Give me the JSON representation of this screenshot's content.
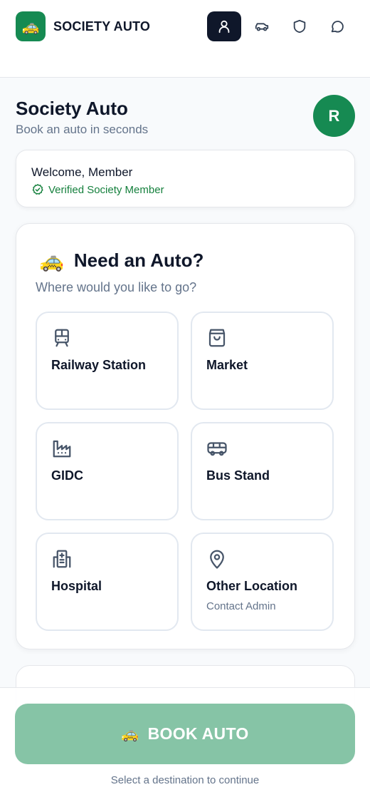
{
  "header": {
    "logo_emoji": "🚕",
    "brand": "SOCIETY AUTO",
    "nav": [
      {
        "icon": "user-icon",
        "active": true
      },
      {
        "icon": "car-icon",
        "active": false
      },
      {
        "icon": "shield-icon",
        "active": false
      },
      {
        "icon": "chat-icon",
        "active": false
      }
    ]
  },
  "page": {
    "title": "Society Auto",
    "subtitle": "Book an auto in seconds",
    "avatar_initial": "R"
  },
  "welcome": {
    "greeting": "Welcome, Member",
    "status": "Verified Society Member"
  },
  "booking": {
    "emoji": "🚕",
    "title": "Need an Auto?",
    "subtitle": "Where would you like to go?",
    "destinations": [
      {
        "label": "Railway Station",
        "icon": "train-icon"
      },
      {
        "label": "Market",
        "icon": "shopping-bag-icon"
      },
      {
        "label": "GIDC",
        "icon": "factory-icon"
      },
      {
        "label": "Bus Stand",
        "icon": "bus-icon"
      },
      {
        "label": "Hospital",
        "icon": "hospital-icon"
      },
      {
        "label": "Other Location",
        "sub": "Contact Admin",
        "icon": "map-pin-icon"
      }
    ]
  },
  "footer": {
    "button_emoji": "🚕",
    "button_label": "BOOK AUTO",
    "hint": "Select a destination to continue"
  },
  "colors": {
    "brand_green": "#168a52",
    "button_disabled": "#86c4a6",
    "nav_active": "#0f172a",
    "verified": "#15803d"
  }
}
